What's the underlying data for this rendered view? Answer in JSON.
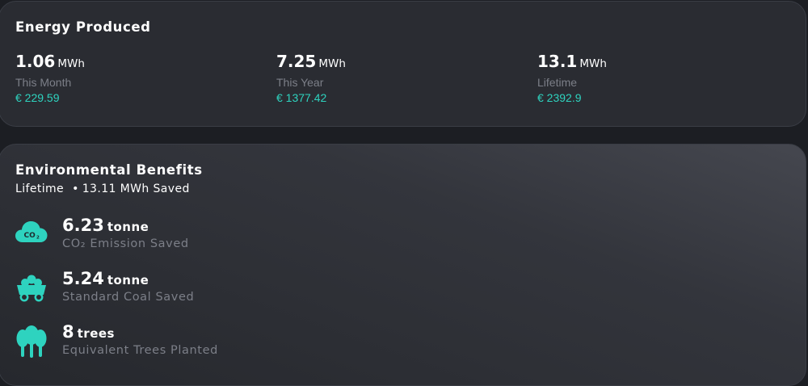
{
  "energy": {
    "title": "Energy Produced",
    "stats": [
      {
        "value": "1.06",
        "unit": "MWh",
        "label": "This Month",
        "money": "€ 229.59"
      },
      {
        "value": "7.25",
        "unit": "MWh",
        "label": "This Year",
        "money": "€ 1377.42"
      },
      {
        "value": "13.1",
        "unit": "MWh",
        "label": "Lifetime",
        "money": "€ 2392.9"
      }
    ]
  },
  "environment": {
    "title": "Environmental Benefits",
    "period": "Lifetime",
    "saved": "13.11 MWh Saved",
    "items": [
      {
        "icon": "co2-cloud-icon",
        "value": "6.23",
        "unit": "tonne",
        "label": "CO₂ Emission Saved"
      },
      {
        "icon": "coal-cart-icon",
        "value": "5.24",
        "unit": "tonne",
        "label": "Standard Coal Saved"
      },
      {
        "icon": "trees-icon",
        "value": "8",
        "unit": "trees",
        "label": "Equivalent Trees Planted"
      }
    ]
  },
  "colors": {
    "accent": "#2ed3bf",
    "background": "#1c1e23",
    "card": "#2a2c32",
    "muted": "#7c7f88"
  }
}
